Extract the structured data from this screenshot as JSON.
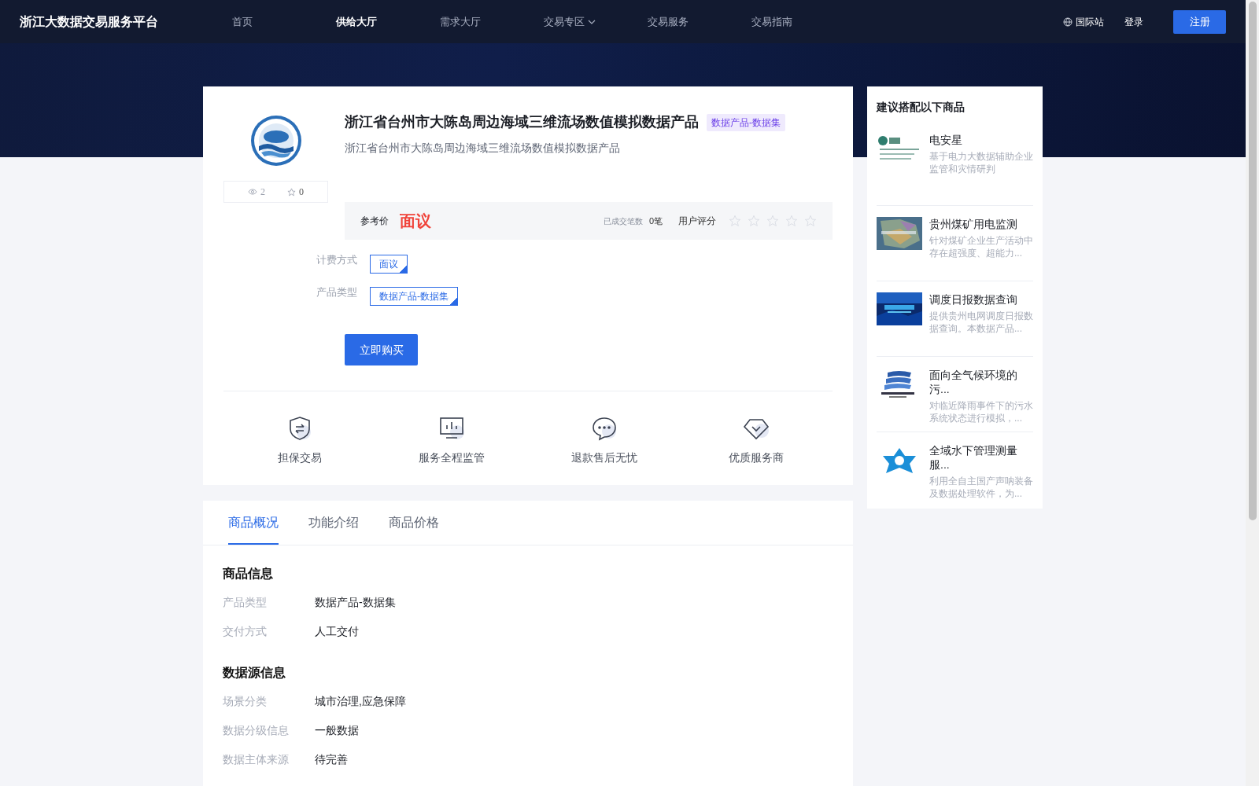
{
  "nav": {
    "logo": "浙江大数据交易服务平台",
    "items": [
      {
        "label": "首页",
        "selected": false,
        "dropdown": false
      },
      {
        "label": "供给大厅",
        "selected": true,
        "dropdown": false
      },
      {
        "label": "需求大厅",
        "selected": false,
        "dropdown": false
      },
      {
        "label": "交易专区",
        "selected": false,
        "dropdown": true
      },
      {
        "label": "交易服务",
        "selected": false,
        "dropdown": false
      },
      {
        "label": "交易指南",
        "selected": false,
        "dropdown": false
      }
    ],
    "lang": "国际站",
    "login": "登录",
    "register": "注册"
  },
  "product": {
    "title": "浙江省台州市大陈岛周边海域三维流场数值模拟数据产品",
    "tag": "数据产品-数据集",
    "subtitle": "浙江省台州市大陈岛周边海域三维流场数值模拟数据产品",
    "views": "2",
    "favorites": "0",
    "price_label": "参考价",
    "price": "面议",
    "deals_label": "已成交笔数",
    "deals": "0笔",
    "rating_label": "用户评分",
    "stars": 0,
    "attributes": [
      {
        "label": "计费方式",
        "value": "面议"
      },
      {
        "label": "产品类型",
        "value": "数据产品-数据集"
      }
    ],
    "buy": "立即购买",
    "guarantees": [
      {
        "kind": "shield",
        "label": "担保交易"
      },
      {
        "kind": "monitor",
        "label": "服务全程监管"
      },
      {
        "kind": "chat",
        "label": "退款售后无忧"
      },
      {
        "kind": "diamond",
        "label": "优质服务商"
      }
    ]
  },
  "sidebar": {
    "title": "建议搭配以下商品",
    "items": [
      {
        "title": "电安星",
        "description": "基于电力大数据辅助企业监管和灾情研判"
      },
      {
        "title": "贵州煤矿用电监测",
        "description": "针对煤矿企业生产活动中存在超强度、超能力..."
      },
      {
        "title": "调度日报数据查询",
        "description": "提供贵州电网调度日报数据查询。本数据产品..."
      },
      {
        "title": "面向全气候环境的污...",
        "description": "对临近降雨事件下的污水系统状态进行模拟，..."
      },
      {
        "title": "全域水下管理测量服...",
        "description": "利用全自主国产声呐装备及数据处理软件，为..."
      }
    ]
  },
  "tabs": [
    {
      "label": "商品概况",
      "selected": true
    },
    {
      "label": "功能介绍",
      "selected": false
    },
    {
      "label": "商品价格",
      "selected": false
    }
  ],
  "sections": [
    {
      "title": "商品信息",
      "rows": [
        {
          "label": "产品类型",
          "value": "数据产品-数据集"
        },
        {
          "label": "交付方式",
          "value": "人工交付"
        }
      ]
    },
    {
      "title": "数据源信息",
      "rows": [
        {
          "label": "场景分类",
          "value": "城市治理,应急保障"
        },
        {
          "label": "数据分级信息",
          "value": "一般数据"
        },
        {
          "label": "数据主体来源",
          "value": "待完善"
        }
      ]
    }
  ]
}
